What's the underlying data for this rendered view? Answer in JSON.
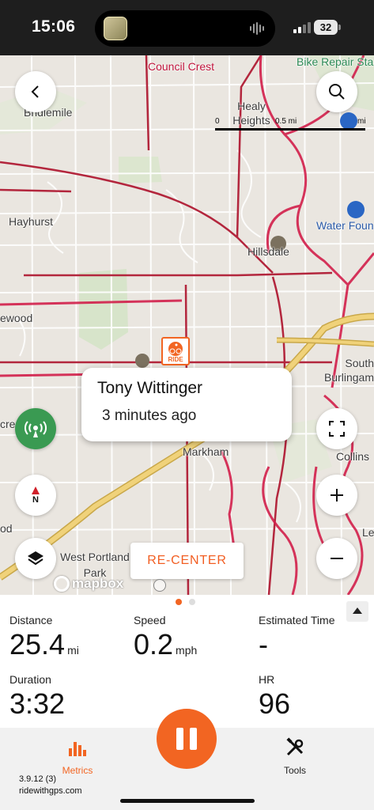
{
  "status_bar": {
    "time": "15:06",
    "battery": "32"
  },
  "map": {
    "places": {
      "council_crest": "Council Crest",
      "bike_repair": "Bike Repair Sta",
      "bridlemile": "Bridlemile",
      "healy_heights": "Healy Heights",
      "hayhurst": "Hayhurst",
      "hillsdale": "Hillsdale",
      "water_fountain": "Water Foun",
      "ewood": "ewood",
      "south_burlingame": "South Burlingam",
      "crest": "cre",
      "markham": "Markham",
      "collins": "Collins",
      "od": "od",
      "west_portland_park": "West Portland Park",
      "le": "Le"
    },
    "scale": {
      "zero": "0",
      "half_mile": "0.5 mi",
      "mi": "mi"
    },
    "popup": {
      "name": "Tony Wittinger",
      "time_ago": "3 minutes ago"
    },
    "ride_marker_label": "RIDE",
    "compass_label": "N",
    "recenter_label": "RE-CENTER",
    "attribution": "mapbox"
  },
  "metrics": {
    "distance": {
      "label": "Distance",
      "value": "25.4",
      "unit": "mi"
    },
    "speed": {
      "label": "Speed",
      "value": "0.2",
      "unit": "mph"
    },
    "estimated_time": {
      "label": "Estimated Time",
      "value": "-"
    },
    "duration": {
      "label": "Duration",
      "value": "3:32"
    },
    "hr": {
      "label": "HR",
      "value": "96"
    }
  },
  "tabbar": {
    "metrics_label": "Metrics",
    "tools_label": "Tools",
    "version": "3.9.12 (3)",
    "site": "ridewithgps.com"
  },
  "colors": {
    "accent": "#f26522",
    "route_red": "#d21f4b",
    "arterial_red": "#b3263d",
    "highway_yellow": "#e6c35a",
    "live_green": "#3a9a52"
  }
}
